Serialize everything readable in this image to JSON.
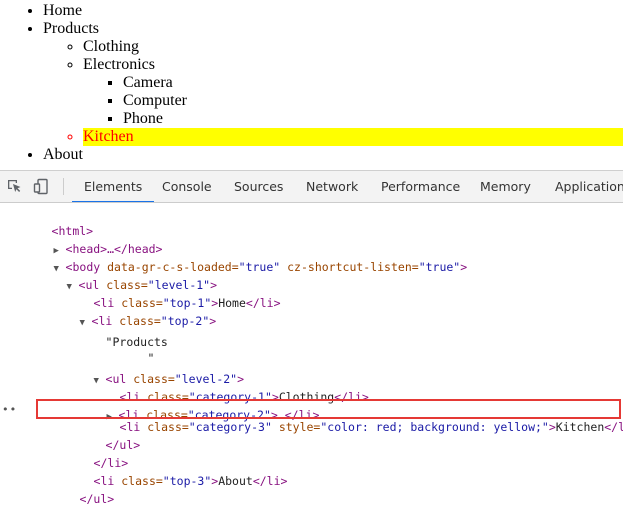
{
  "page": {
    "items": {
      "home": "Home",
      "products": "Products",
      "clothing": "Clothing",
      "electronics": "Electronics",
      "camera": "Camera",
      "computer": "Computer",
      "phone": "Phone",
      "kitchen": "Kitchen",
      "about": "About"
    },
    "highlight_colors": {
      "text": "#ff0000",
      "background": "#ffff00"
    }
  },
  "devtools": {
    "tabs": [
      "Elements",
      "Console",
      "Sources",
      "Network",
      "Performance",
      "Memory",
      "Application"
    ],
    "active_tab": "Elements",
    "icons": {
      "inspect": "inspect-element-icon",
      "device": "device-toolbar-icon"
    },
    "dom": {
      "html_open": "<html>",
      "head": "<head>…</head>",
      "body_open_tag": "<body",
      "body_attr1": " data-gr-c-s-loaded=",
      "body_val1": "\"true\"",
      "body_attr2": " cz-shortcut-listen=",
      "body_val2": "\"true\"",
      "body_close": ">",
      "ul1_tag": "<ul",
      "ul1_attr": " class=",
      "ul1_val": "\"level-1\"",
      "ul1_end": ">",
      "li_top1_open": "<li",
      "li_top1_attr": " class=",
      "li_top1_val": "\"top-1\"",
      "li_top1_gt": ">",
      "li_top1_text": "Home",
      "li_top1_close": "</li>",
      "li_top2_open": "<li",
      "li_top2_attr": " class=",
      "li_top2_val": "\"top-2\"",
      "li_top2_gt": ">",
      "products_text": "\"Products",
      "products_quote": "\"",
      "ul2_tag": "<ul",
      "ul2_attr": " class=",
      "ul2_val": "\"level-2\"",
      "ul2_end": ">",
      "cat1_open": "<li",
      "cat1_attr": " class=",
      "cat1_val": "\"category-1\"",
      "cat1_gt": ">",
      "cat1_text": "Clothing",
      "cat1_close": "</li>",
      "cat2_open": "<li",
      "cat2_attr": " class=",
      "cat2_val": "\"category-2\"",
      "cat2_gt": ">…",
      "cat2_close": "</li>",
      "cat3_open": "<li",
      "cat3_attr": " class=",
      "cat3_val": "\"category-3\"",
      "cat3_attr2": " style=",
      "cat3_val2": "\"color: red; background: yellow;\"",
      "cat3_gt": ">",
      "cat3_text": "Kitchen",
      "cat3_close": "</li",
      "ul2_close": "</ul>",
      "li_top2_close": "</li>",
      "li_top3_open": "<li",
      "li_top3_attr": " class=",
      "li_top3_val": "\"top-3\"",
      "li_top3_gt": ">",
      "li_top3_text": "About",
      "li_top3_close": "</li>",
      "ul1_close": "</ul>",
      "dots": "••"
    }
  }
}
